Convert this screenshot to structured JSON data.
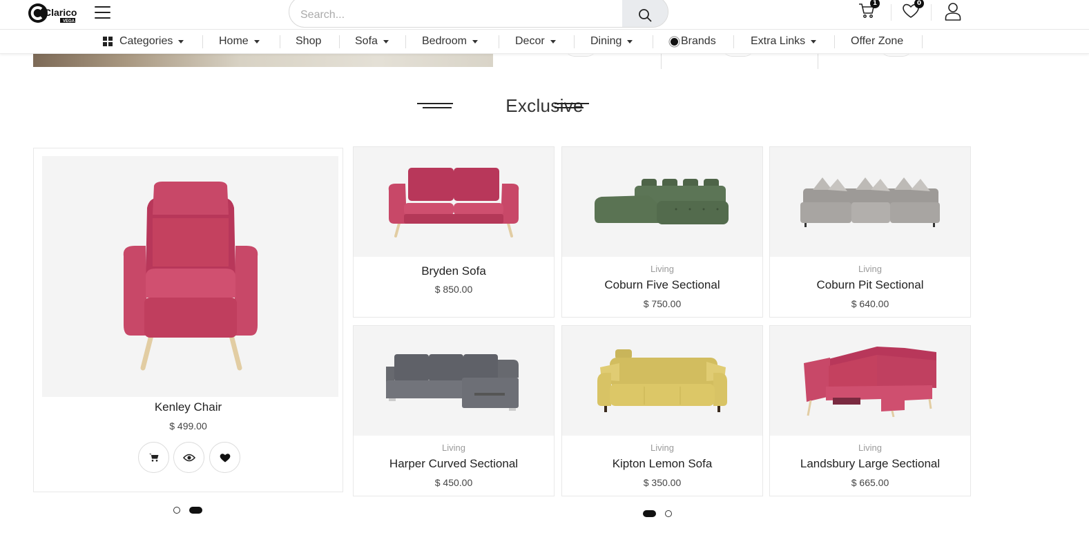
{
  "header": {
    "logo_text": "Clarico",
    "logo_sub": "VEGA",
    "search_placeholder": "Search...",
    "cart_count": "1",
    "wishlist_count": "0"
  },
  "nav": {
    "items": [
      {
        "label": "Categories",
        "icon": "grid-icon",
        "caret": true
      },
      {
        "label": "Home",
        "caret": true
      },
      {
        "label": "Shop",
        "caret": false
      },
      {
        "label": "Sofa",
        "caret": true
      },
      {
        "label": "Bedroom",
        "caret": true
      },
      {
        "label": "Decor",
        "caret": true
      },
      {
        "label": "Dining",
        "caret": true
      },
      {
        "label": "Brands",
        "icon": "radio-icon",
        "caret": false
      },
      {
        "label": "Extra Links",
        "caret": true
      },
      {
        "label": "Offer Zone",
        "caret": false
      }
    ]
  },
  "section": {
    "title": "Exclusive"
  },
  "featured": {
    "name": "Kenley Chair",
    "price": "$ 499.00",
    "color": "#c4415f"
  },
  "products": [
    {
      "category": "",
      "name": "Bryden Sofa",
      "price": "$ 850.00",
      "color": "#c4415f"
    },
    {
      "category": "Living",
      "name": "Coburn Five Sectional",
      "price": "$ 750.00",
      "color": "#556b4f"
    },
    {
      "category": "Living",
      "name": "Coburn Pit Sectional",
      "price": "$ 640.00",
      "color": "#a9a7a4"
    },
    {
      "category": "Living",
      "name": "Harper Curved Sectional",
      "price": "$ 450.00",
      "color": "#6f7178"
    },
    {
      "category": "Living",
      "name": "Kipton Lemon Sofa",
      "price": "$ 350.00",
      "color": "#d9c467"
    },
    {
      "category": "Living",
      "name": "Landsbury Large Sectional",
      "price": "$ 665.00",
      "color": "#c94a6a"
    }
  ],
  "carousel": {
    "left_active_index": 1,
    "right_active_index": 0
  }
}
